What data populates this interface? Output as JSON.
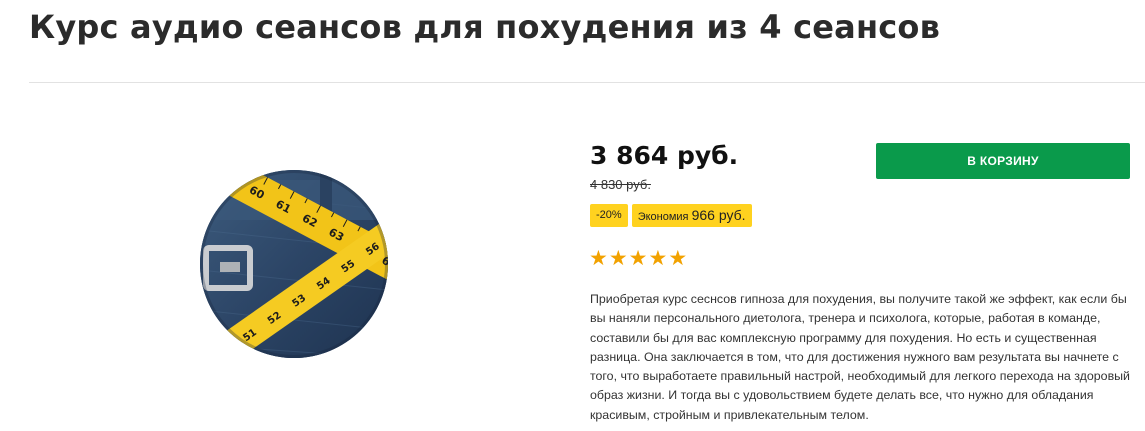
{
  "product": {
    "title": "Курс аудио сеансов для похудения из 4 сеансов",
    "image_alt": "measuring-tape-on-jeans",
    "price": "3 864 руб.",
    "old_price": "4 830 руб.",
    "discount_badge": "-20%",
    "savings_label": "Экономия",
    "savings_amount": "966 руб.",
    "rating": 5,
    "rating_max": 5,
    "stars": "★★★★★",
    "description": "Приобретая курс сеснсов гипноза для похудения, вы получите такой же эффект, как если бы вы наняли персонального диетолога, тренера и психолога, которые, работая в команде, составили бы для вас комплексную программу для похудения. Но есть и существенная разница. Она заключается в том, что для достижения нужного вам результата вы начнете с того, что выработаете правильный настрой, необходимый для легкого перехода на здоровый образ жизни. И тогда вы с удовольствием будете делать все, что нужно для обладания красивым, стройным и привлекательным телом."
  },
  "cart": {
    "button_label": "В КОРЗИНУ"
  },
  "colors": {
    "cart_button": "#0a9a4b",
    "badge": "#ffd21f",
    "stars": "#f2a200"
  }
}
